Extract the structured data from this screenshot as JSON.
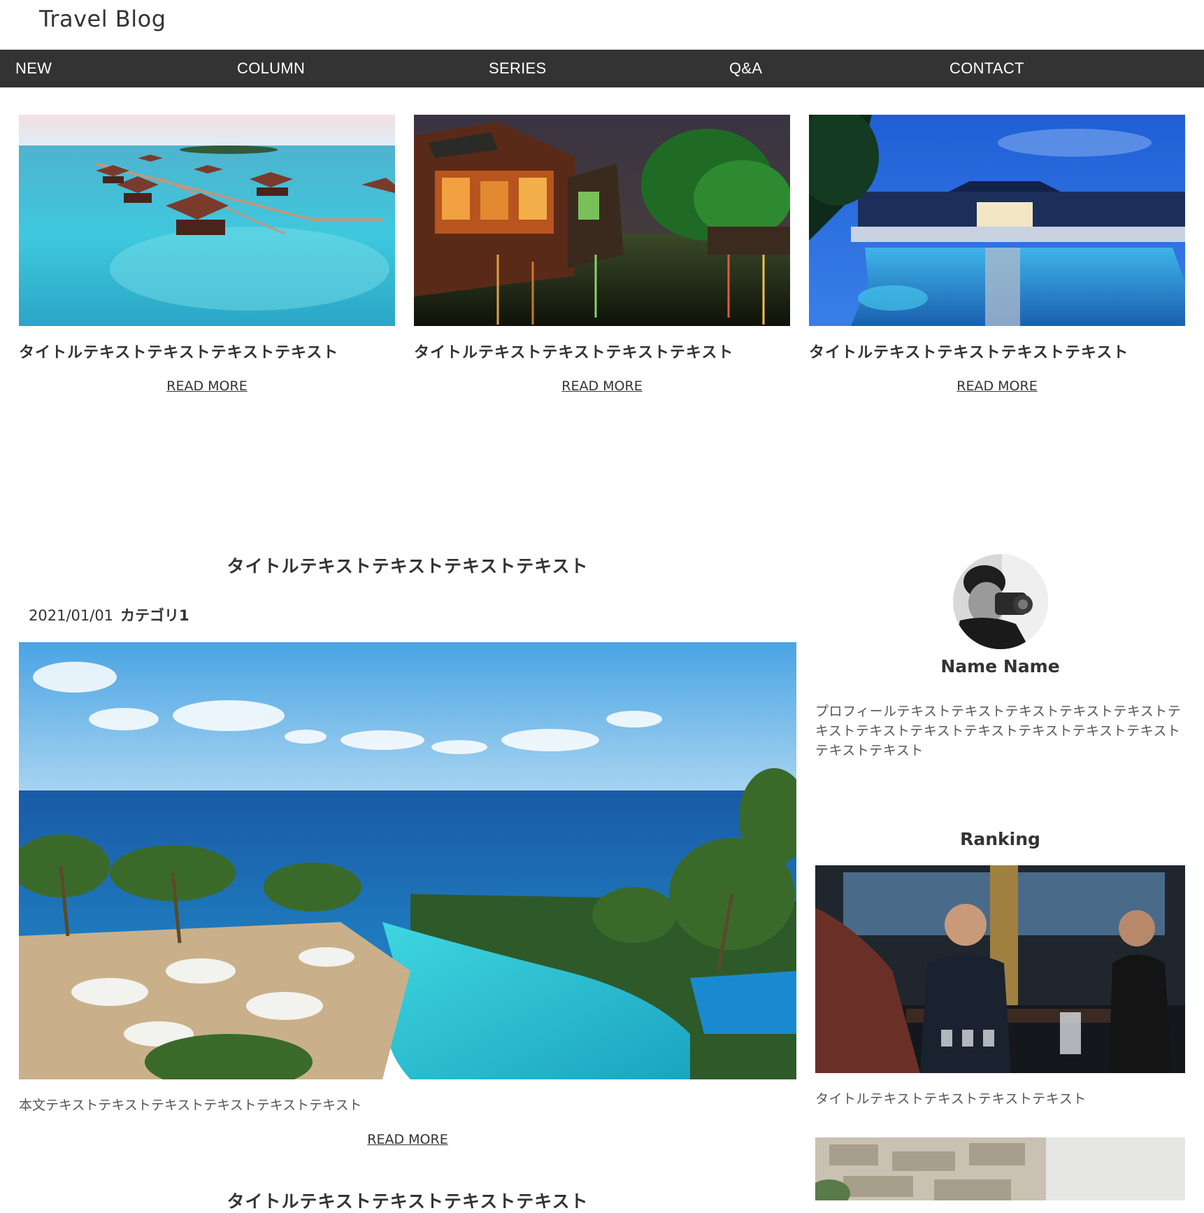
{
  "header": {
    "site_title": "Travel Blog"
  },
  "nav": {
    "items": [
      {
        "label": "NEW"
      },
      {
        "label": "COLUMN"
      },
      {
        "label": "SERIES"
      },
      {
        "label": "Q&A"
      },
      {
        "label": "CONTACT"
      }
    ]
  },
  "featured": {
    "cards": [
      {
        "title": "タイトルテキストテキストテキストテキスト",
        "read_more": "READ MORE",
        "image": "overwater-villas-photo"
      },
      {
        "title": "タイトルテキストテキストテキストテキスト",
        "read_more": "READ MORE",
        "image": "canal-town-night-photo"
      },
      {
        "title": "タイトルテキストテキストテキストテキスト",
        "read_more": "READ MORE",
        "image": "resort-pool-night-photo"
      }
    ]
  },
  "article": {
    "title": "タイトルテキストテキストテキストテキスト",
    "date": "2021/01/01",
    "category": "カテゴリ1",
    "image": "ocean-resort-pool-photo",
    "body": "本文テキストテキストテキストテキストテキストテキスト",
    "read_more": "READ MORE"
  },
  "next_article": {
    "title": "タイトルテキストテキストテキストテキスト"
  },
  "sidebar": {
    "profile": {
      "name": "Name Name",
      "text": "プロフィールテキストテキストテキストテキストテキストテキストテキストテキストテキストテキストテキストテキストテキストテキスト",
      "avatar": "photographer-avatar"
    },
    "ranking": {
      "heading": "Ranking",
      "items": [
        {
          "title": "タイトルテキストテキストテキストテキスト",
          "image": "cafe-baristas-photo"
        }
      ]
    }
  },
  "colors": {
    "nav_background": "#333333",
    "text": "#333333",
    "background": "#ffffff"
  }
}
